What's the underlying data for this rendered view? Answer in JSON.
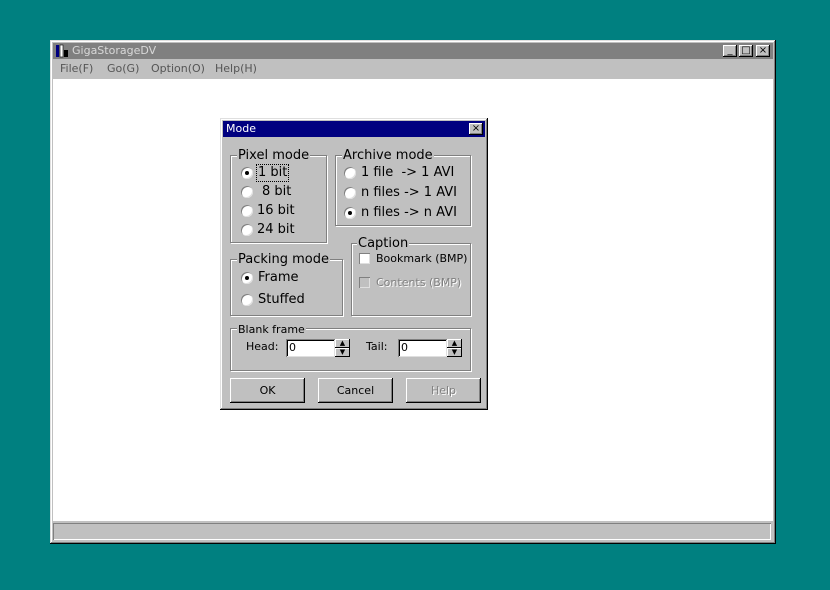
{
  "window": {
    "title": "GigaStorageDV",
    "controls": {
      "minimize": "_",
      "maximize": "□",
      "close": "×"
    }
  },
  "menu": {
    "items": [
      "File(F)",
      "Go(G)",
      "Option(O)",
      "Help(H)"
    ]
  },
  "dialog": {
    "title": "Mode",
    "close_glyph": "×",
    "pixel_mode": {
      "label": "Pixel mode",
      "options": [
        "1 bit",
        "8 bit",
        "16 bit",
        "24 bit"
      ],
      "selected": "1 bit"
    },
    "archive_mode": {
      "label": "Archive mode",
      "options": [
        "1 file  -> 1 AVI",
        "n files -> 1 AVI",
        "n files -> n AVI"
      ],
      "selected": "n files -> n AVI"
    },
    "packing_mode": {
      "label": "Packing mode",
      "options": [
        "Frame",
        "Stuffed"
      ],
      "selected": "Frame"
    },
    "caption": {
      "label": "Caption",
      "bookmark": {
        "label": "Bookmark (BMP)",
        "checked": false,
        "enabled": true
      },
      "contents": {
        "label": "Contents (BMP)",
        "checked": false,
        "enabled": false
      }
    },
    "blank_frame": {
      "label": "Blank frame",
      "head_label": "Head:",
      "head_value": "0",
      "tail_label": "Tail:",
      "tail_value": "0"
    },
    "buttons": {
      "ok": "OK",
      "cancel": "Cancel",
      "help": "Help"
    }
  },
  "icons": {
    "app": "app-icon",
    "spin_up": "▲",
    "spin_down": "▼"
  },
  "colors": {
    "desktop": "#008080",
    "titlebar_inactive": "#808080",
    "titlebar_active": "#000080",
    "face": "#c0c0c0"
  }
}
